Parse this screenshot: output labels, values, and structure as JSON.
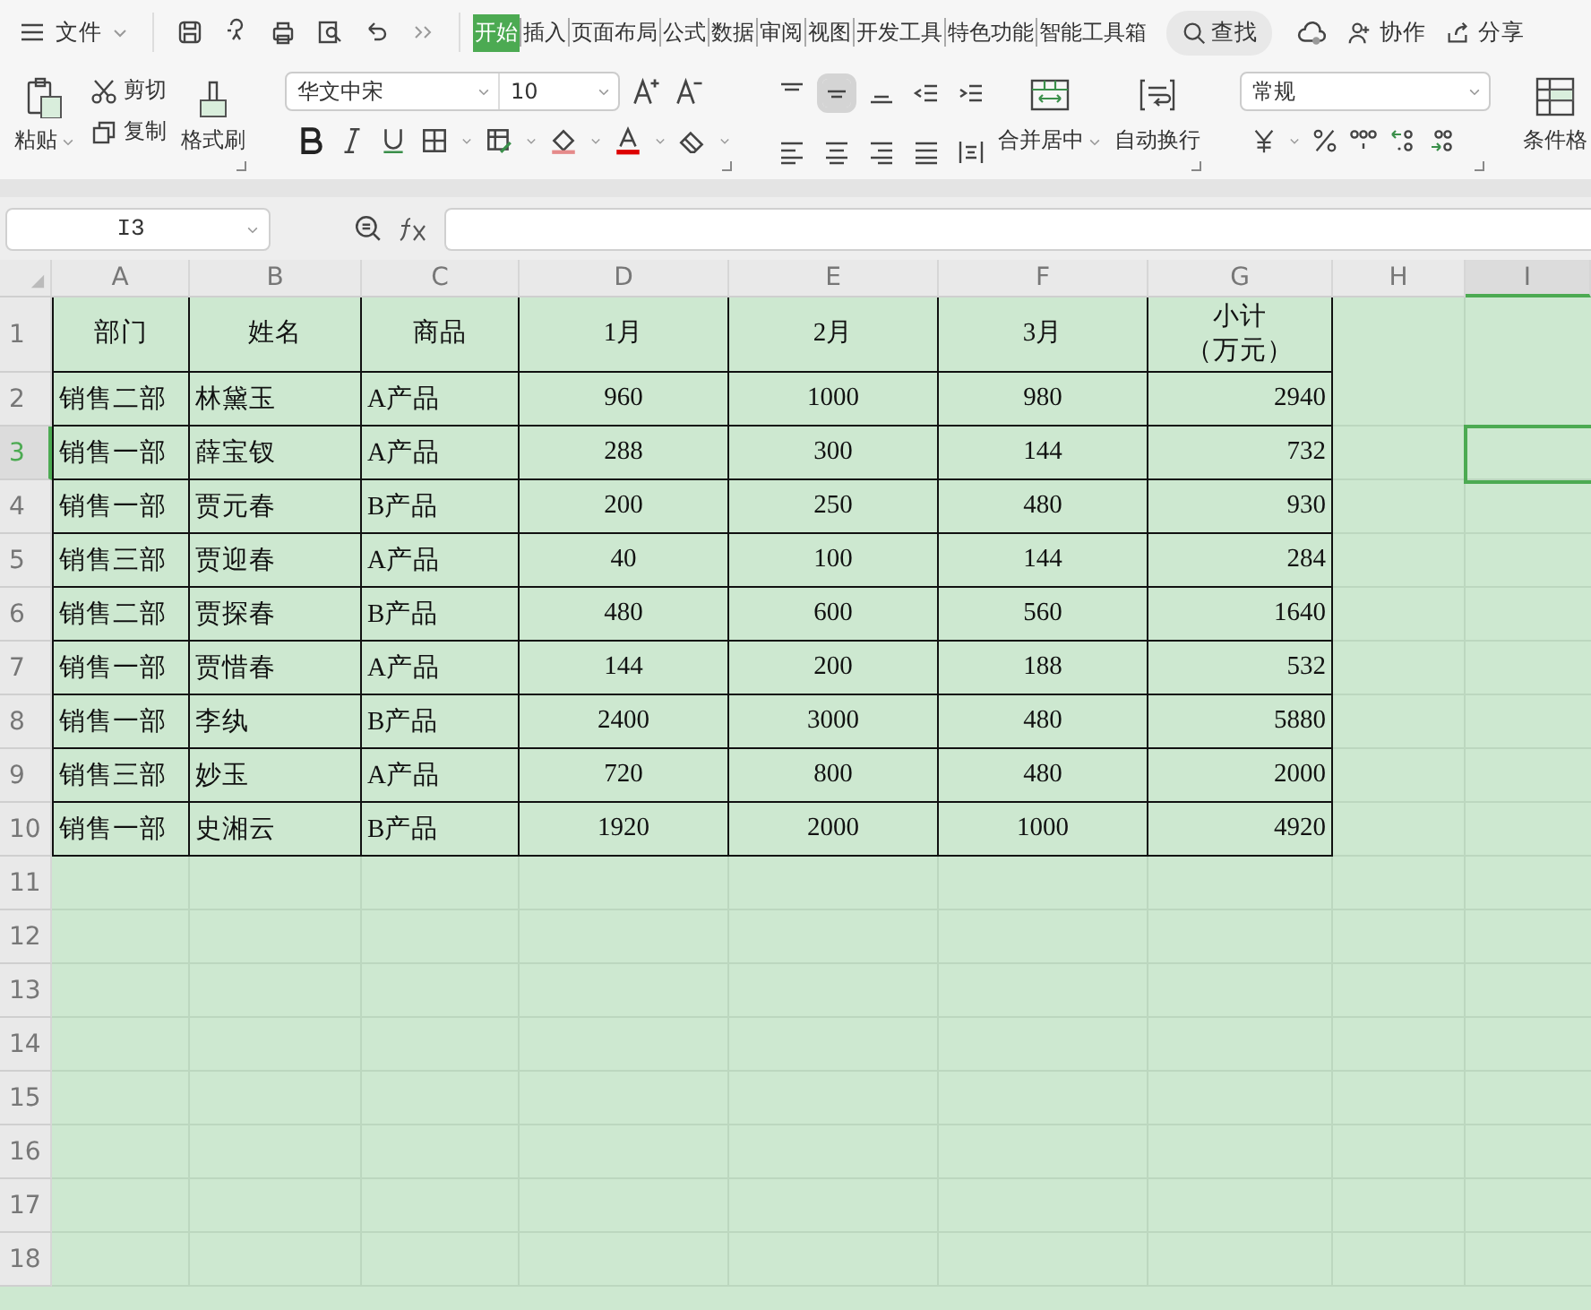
{
  "menu_bar": {
    "file_menu": "文件",
    "tabs": [
      {
        "label": "开始",
        "selected": true
      },
      {
        "label": "插入",
        "selected": false
      },
      {
        "label": "页面布局",
        "selected": false
      },
      {
        "label": "公式",
        "selected": false
      },
      {
        "label": "数据",
        "selected": false
      },
      {
        "label": "审阅",
        "selected": false
      },
      {
        "label": "视图",
        "selected": false
      },
      {
        "label": "开发工具",
        "selected": false
      },
      {
        "label": "特色功能",
        "selected": false
      },
      {
        "label": "智能工具箱",
        "selected": false
      }
    ],
    "search": "查找",
    "actions": [
      "协作",
      "分享"
    ]
  },
  "ribbon": {
    "paste": "粘贴",
    "cut": "剪切",
    "copy": "复制",
    "format_painter": "格式刷",
    "font_name": "华文中宋",
    "font_size": "10",
    "merge_center": "合并居中",
    "wrap_text": "自动换行",
    "number_format": "常规",
    "conditional_format": "条件格"
  },
  "formula_bar": {
    "name_box": "I3"
  },
  "sheet": {
    "columns": [
      {
        "label": "A",
        "selected": false
      },
      {
        "label": "B",
        "selected": false
      },
      {
        "label": "C",
        "selected": false
      },
      {
        "label": "D",
        "selected": false
      },
      {
        "label": "E",
        "selected": false
      },
      {
        "label": "F",
        "selected": false
      },
      {
        "label": "G",
        "selected": false
      },
      {
        "label": "H",
        "selected": false
      },
      {
        "label": "I",
        "selected": true
      }
    ],
    "rows": [
      {
        "label": "1",
        "selected": false,
        "kind": "header",
        "cells": [
          "部门",
          "姓名",
          "商品",
          "1月",
          "2月",
          "3月",
          [
            "小计",
            "（万元）"
          ]
        ]
      },
      {
        "label": "2",
        "selected": false,
        "kind": "data",
        "cells": [
          "销售二部",
          "林黛玉",
          "A产品",
          "960",
          "1000",
          "980",
          "2940"
        ]
      },
      {
        "label": "3",
        "selected": true,
        "kind": "data",
        "cells": [
          "销售一部",
          "薛宝钗",
          "A产品",
          "288",
          "300",
          "144",
          "732"
        ]
      },
      {
        "label": "4",
        "selected": false,
        "kind": "data",
        "cells": [
          "销售一部",
          "贾元春",
          "B产品",
          "200",
          "250",
          "480",
          "930"
        ]
      },
      {
        "label": "5",
        "selected": false,
        "kind": "data",
        "cells": [
          "销售三部",
          "贾迎春",
          "A产品",
          "40",
          "100",
          "144",
          "284"
        ]
      },
      {
        "label": "6",
        "selected": false,
        "kind": "data",
        "cells": [
          "销售二部",
          "贾探春",
          "B产品",
          "480",
          "600",
          "560",
          "1640"
        ]
      },
      {
        "label": "7",
        "selected": false,
        "kind": "data",
        "cells": [
          "销售一部",
          "贾惜春",
          "A产品",
          "144",
          "200",
          "188",
          "532"
        ]
      },
      {
        "label": "8",
        "selected": false,
        "kind": "data",
        "cells": [
          "销售一部",
          "李纨",
          "B产品",
          "2400",
          "3000",
          "480",
          "5880"
        ]
      },
      {
        "label": "9",
        "selected": false,
        "kind": "data",
        "cells": [
          "销售三部",
          "妙玉",
          "A产品",
          "720",
          "800",
          "480",
          "2000"
        ]
      },
      {
        "label": "10",
        "selected": false,
        "kind": "data",
        "cells": [
          "销售一部",
          "史湘云",
          "B产品",
          "1920",
          "2000",
          "1000",
          "4920"
        ]
      },
      {
        "label": "11",
        "selected": false,
        "kind": "empty"
      },
      {
        "label": "12",
        "selected": false,
        "kind": "empty"
      },
      {
        "label": "13",
        "selected": false,
        "kind": "empty"
      },
      {
        "label": "14",
        "selected": false,
        "kind": "empty"
      },
      {
        "label": "15",
        "selected": false,
        "kind": "empty"
      },
      {
        "label": "16",
        "selected": false,
        "kind": "empty"
      },
      {
        "label": "17",
        "selected": false,
        "kind": "empty"
      },
      {
        "label": "18",
        "selected": false,
        "kind": "empty"
      }
    ]
  }
}
